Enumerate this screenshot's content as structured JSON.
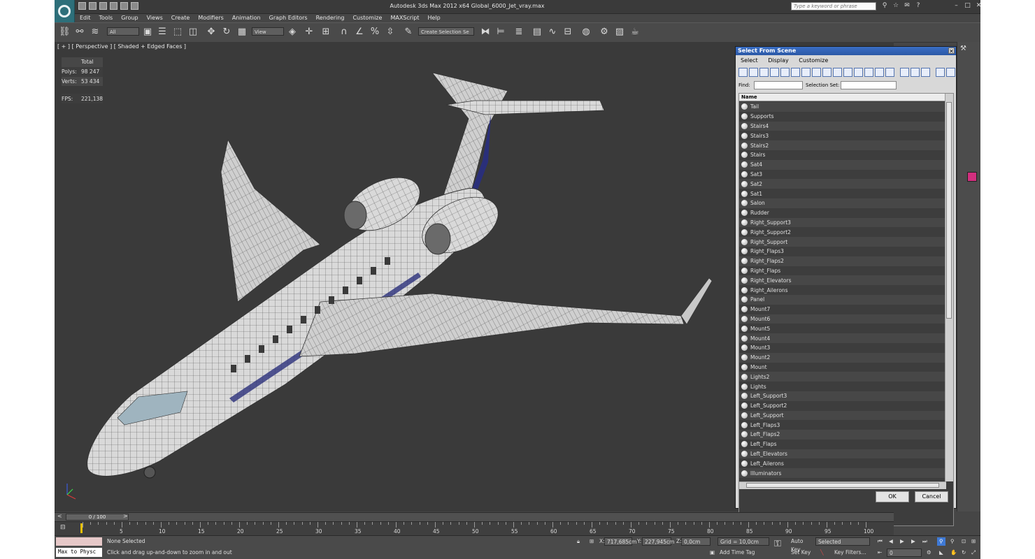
{
  "titlebar": {
    "title": "Autodesk 3ds Max  2012 x64     Global_6000_Jet_vray.max",
    "search_placeholder": "Type a keyword or phrase"
  },
  "menu": [
    "Edit",
    "Tools",
    "Group",
    "Views",
    "Create",
    "Modifiers",
    "Animation",
    "Graph Editors",
    "Rendering",
    "Customize",
    "MAXScript",
    "Help"
  ],
  "toolbar": {
    "selection_filter": "All",
    "ref_coord": "View",
    "named_selection": "Create Selection Se"
  },
  "viewport": {
    "label": "[ + ] [ Perspective ] [ Shaded + Edged Faces ]",
    "stats": {
      "total_label": "Total",
      "polys_label": "Polys:",
      "polys": "98 247",
      "verts_label": "Verts:",
      "verts": "53 434",
      "fps_label": "FPS:",
      "fps": "221,138"
    }
  },
  "dialog": {
    "title": "Select From Scene",
    "menu": [
      "Select",
      "Display",
      "Customize"
    ],
    "find_label": "Find:",
    "selection_set_label": "Selection Set:",
    "column_header": "Name",
    "items": [
      "Tail",
      "Supports",
      "Stairs4",
      "Stairs3",
      "Stairs2",
      "Stairs",
      "Sat4",
      "Sat3",
      "Sat2",
      "Sat1",
      "Salon",
      "Rudder",
      "Right_Support3",
      "Right_Support2",
      "Right_Support",
      "Right_Flaps3",
      "Right_Flaps2",
      "Right_Flaps",
      "Right_Elevators",
      "Right_Ailerons",
      "Panel",
      "Mount7",
      "Mount6",
      "Mount5",
      "Mount4",
      "Mount3",
      "Mount2",
      "Mount",
      "Lights2",
      "Lights",
      "Left_Support3",
      "Left_Support2",
      "Left_Support",
      "Left_Flaps3",
      "Left_Flaps2",
      "Left_Flaps",
      "Left_Elevators",
      "Left_Ailerons",
      "Illuminators"
    ],
    "ok_label": "OK",
    "cancel_label": "Cancel"
  },
  "timeline": {
    "frame_display": "0 / 100",
    "ticks": [
      "5",
      "10",
      "15",
      "20",
      "25",
      "30",
      "35",
      "40",
      "45",
      "50",
      "55",
      "60",
      "65",
      "70",
      "75",
      "80",
      "85",
      "90",
      "95",
      "100"
    ]
  },
  "status": {
    "script_listener": "Max to Physc",
    "selection": "None Selected",
    "prompt": "Click and drag up-and-down to zoom in and out",
    "x_label": "X:",
    "x_value": "717,685cm",
    "y_label": "Y:",
    "y_value": "227,945cm",
    "z_label": "Z:",
    "z_value": "0,0cm",
    "grid": "Grid = 10,0cm",
    "add_time_tag": "Add Time Tag",
    "auto_key": "Auto Key",
    "set_key": "Set Key",
    "key_mode": "Selected",
    "key_filters": "Key Filters...",
    "current_frame": "0"
  },
  "colors": {
    "viewport_bg": "#3a3a3a",
    "stats_text": "#e8d800",
    "dialog_title": "#2b58a6",
    "app_logo": "#2d6f7a"
  }
}
